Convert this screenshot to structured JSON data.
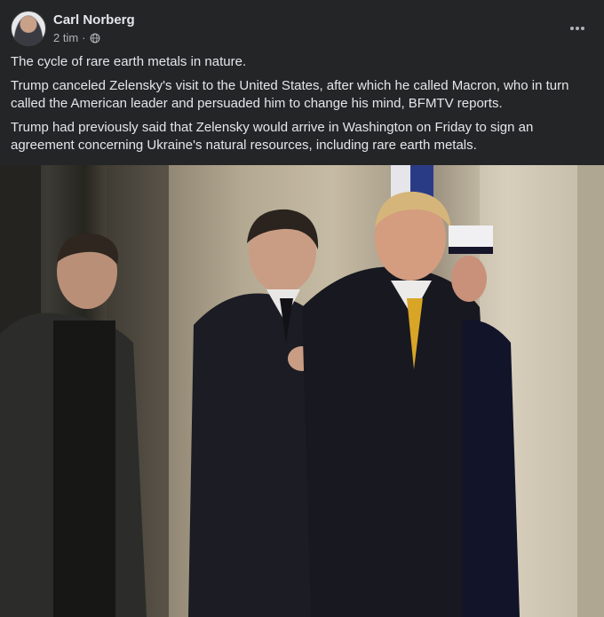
{
  "post": {
    "author": "Carl Norberg",
    "time": "2 tim",
    "separator": "·",
    "privacy_icon": "globe-icon",
    "more_icon": "more-horizontal-icon",
    "paragraphs": [
      "The cycle of rare earth metals in nature.",
      "Trump canceled Zelensky's visit to the United States, after which he called Macron, who in turn called the American leader and persuaded him to change his mind, BFMTV reports.",
      "Trump had previously said that Zelensky would arrive in Washington on Friday to sign an agreement concerning Ukraine's natural resources, including rare earth metals."
    ],
    "photo_subject": "three-men-at-palace-entrance"
  },
  "colors": {
    "background": "#242526",
    "primary_text": "#e4e6eb",
    "secondary_text": "#b0b3b8"
  }
}
